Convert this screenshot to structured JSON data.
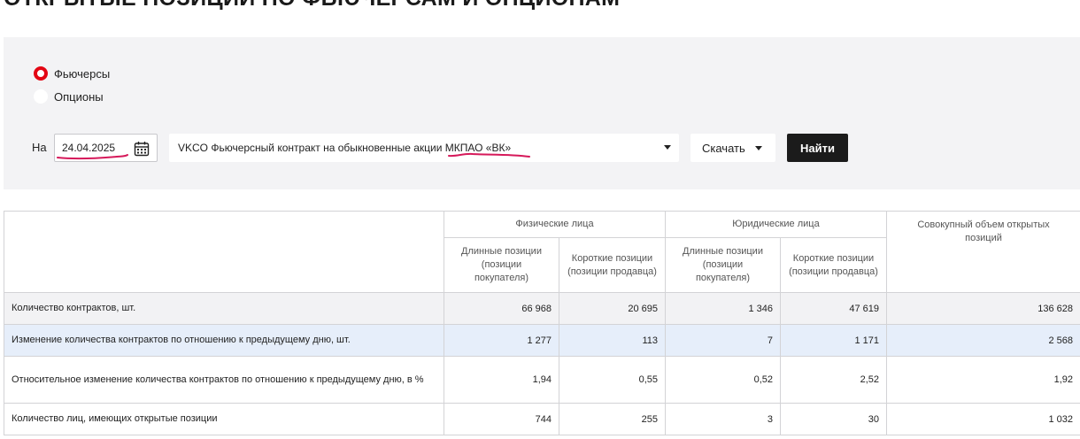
{
  "page": {
    "title": "ОТКРЫТЫЕ ПОЗИЦИИ ПО ФЬЮЧЕРСАМ И ОПЦИОНАМ"
  },
  "filters": {
    "instrument_types": [
      {
        "label": "Фьючерсы",
        "checked": true
      },
      {
        "label": "Опционы",
        "checked": false
      }
    ],
    "date_label": "На",
    "date_value": "24.04.2025",
    "contract_value": "VKCO Фьючерсный контракт на обыкновенные акции МКПАО «ВК»",
    "download_label": "Скачать",
    "find_label": "Найти"
  },
  "colors": {
    "accent_red": "#e30613",
    "annotation_pen": "#d6195a",
    "button_dark": "#1b1b1b",
    "panel_bg": "#f3f3f5",
    "row_highlight": "#e6eefa"
  },
  "table": {
    "group_headers": {
      "individuals": "Физические лица",
      "legal": "Юридические лица",
      "total": "Совокупный объем открытых позиций"
    },
    "sub_headers": {
      "long": "Длинные позиции (позиции покупателя)",
      "short": "Короткие позиции (позиции продавца)"
    },
    "rows": [
      {
        "label": "Количество контрактов, шт.",
        "values": [
          "66 968",
          "20 695",
          "1 346",
          "47 619",
          "136 628"
        ]
      },
      {
        "label": "Изменение количества контрактов по отношению к предыдущему дню, шт.",
        "values": [
          "1 277",
          "113",
          "7",
          "1 171",
          "2 568"
        ]
      },
      {
        "label": "Относительное изменение количества контрактов по отношению к предыдущему дню, в %",
        "values": [
          "1,94",
          "0,55",
          "0,52",
          "2,52",
          "1,92"
        ]
      },
      {
        "label": "Количество лиц, имеющих открытые позиции",
        "values": [
          "744",
          "255",
          "3",
          "30",
          "1 032"
        ]
      }
    ]
  }
}
